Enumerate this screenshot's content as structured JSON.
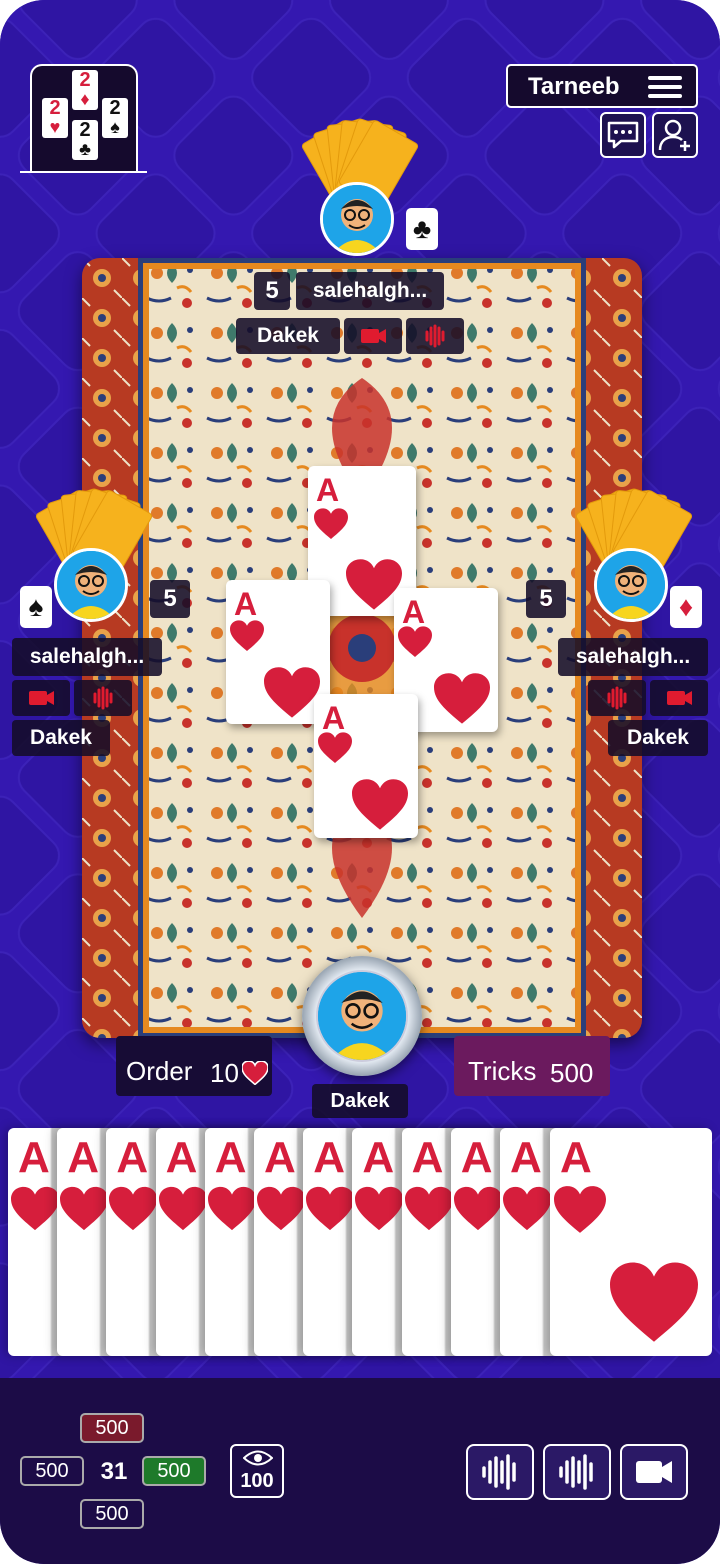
{
  "app": {
    "title": "Tarneeb"
  },
  "logo": {
    "cards": [
      {
        "rank": "2",
        "suit": "♥",
        "color": "#d61e3c"
      },
      {
        "rank": "2",
        "suit": "♦",
        "color": "#d61e3c"
      },
      {
        "rank": "2",
        "suit": "♣",
        "color": "#111111"
      },
      {
        "rank": "2",
        "suit": "♠",
        "color": "#111111"
      }
    ]
  },
  "players": {
    "top": {
      "name": "salehalgh...",
      "score": "5",
      "team": "Dakek",
      "suit": "♣",
      "suit_color": "#111111"
    },
    "left": {
      "name": "salehalgh...",
      "score": "5",
      "team": "Dakek",
      "suit": "♠",
      "suit_color": "#111111"
    },
    "right": {
      "name": "salehalgh...",
      "score": "5",
      "team": "Dakek",
      "suit": "♦",
      "suit_color": "#d61e3c"
    },
    "self": {
      "team": "Dakek"
    }
  },
  "table": {
    "played_cards": [
      {
        "position": "top",
        "rank": "A",
        "suit": "hearts"
      },
      {
        "position": "left",
        "rank": "A",
        "suit": "hearts"
      },
      {
        "position": "right",
        "rank": "A",
        "suit": "hearts"
      },
      {
        "position": "bottom",
        "rank": "A",
        "suit": "hearts"
      }
    ]
  },
  "status": {
    "order_label": "Order",
    "order_value": "10",
    "tricks_label": "Tricks",
    "tricks_value": "500"
  },
  "hand": {
    "cards": [
      "A",
      "A",
      "A",
      "A",
      "A",
      "A",
      "A",
      "A",
      "A",
      "A",
      "A",
      "A"
    ],
    "suit": "hearts"
  },
  "chips": {
    "top": "500",
    "left": "500",
    "center": "31",
    "right": "500",
    "bottom": "500"
  },
  "spectators": {
    "count": "100"
  },
  "colors": {
    "background": "#3418b0",
    "hearts_red": "#d61e3c",
    "card_back": "#f6b21d",
    "bottom_bar": "#1c0c47",
    "chip_red": "#7a1a2c",
    "chip_green": "#1e7a2a",
    "tricks_bg": "#6b1a5e"
  },
  "icons": {
    "chat": "chat-icon",
    "add_friend": "add-user-icon",
    "menu": "menu-icon",
    "eye": "eye-icon",
    "mic": "voice-wave-icon",
    "video": "video-camera-icon"
  }
}
